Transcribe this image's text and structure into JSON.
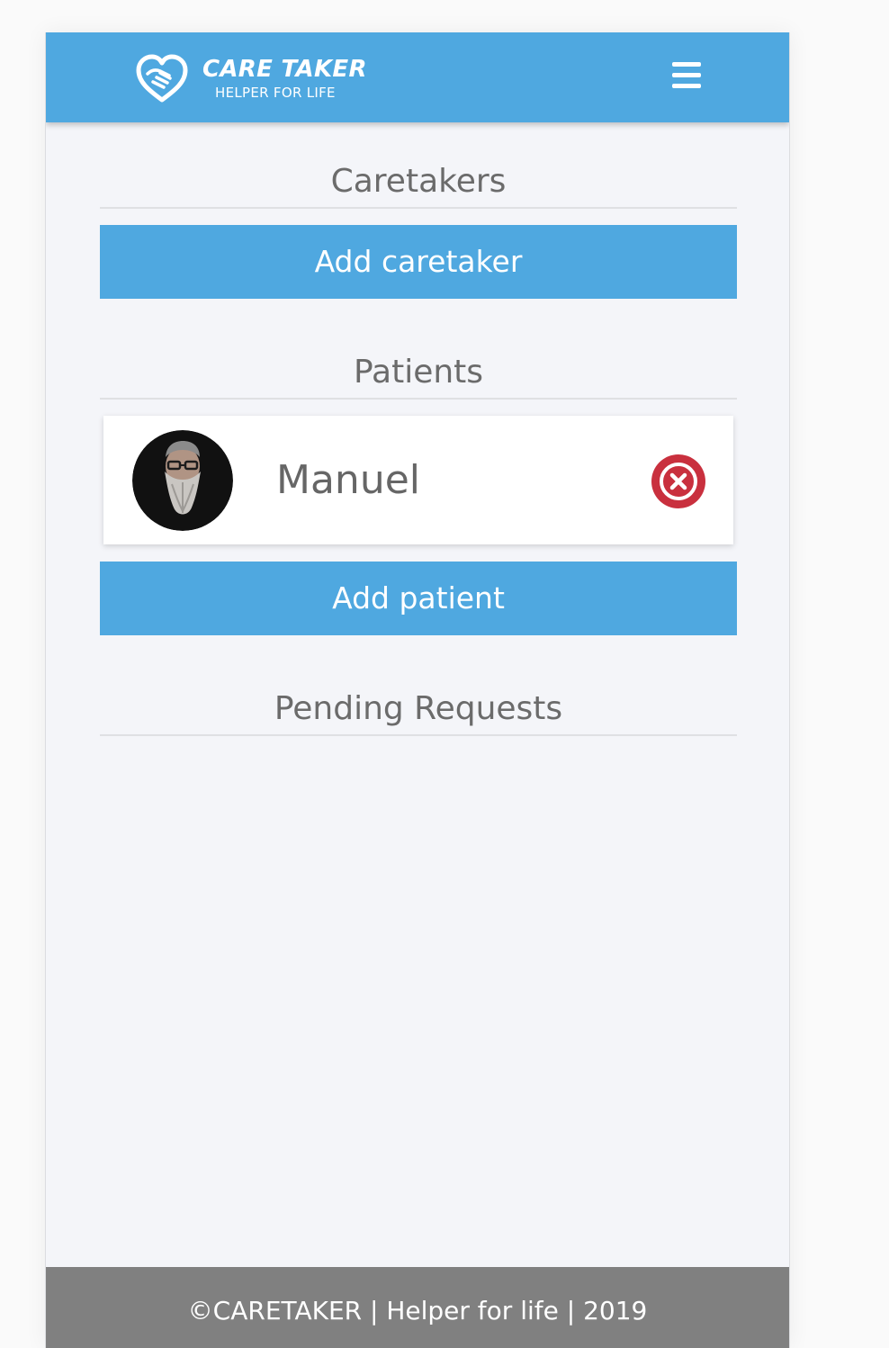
{
  "header": {
    "brand_title": "CARE TAKER",
    "brand_subtitle": "HELPER FOR LIFE",
    "logo_icon": "heart-hands-icon",
    "menu_icon": "hamburger-menu-icon",
    "brand_color": "#4fa8e0"
  },
  "sections": {
    "caretakers": {
      "title": "Caretakers",
      "add_button_label": "Add caretaker"
    },
    "patients": {
      "title": "Patients",
      "items": [
        {
          "name": "Manuel",
          "avatar_icon": "bearded-man-avatar",
          "remove_icon": "remove-circle-x-icon",
          "remove_color": "#c9303e"
        }
      ],
      "add_button_label": "Add patient"
    },
    "pending_requests": {
      "title": "Pending Requests"
    }
  },
  "footer": {
    "text": "©CARETAKER | Helper for life | 2019"
  }
}
